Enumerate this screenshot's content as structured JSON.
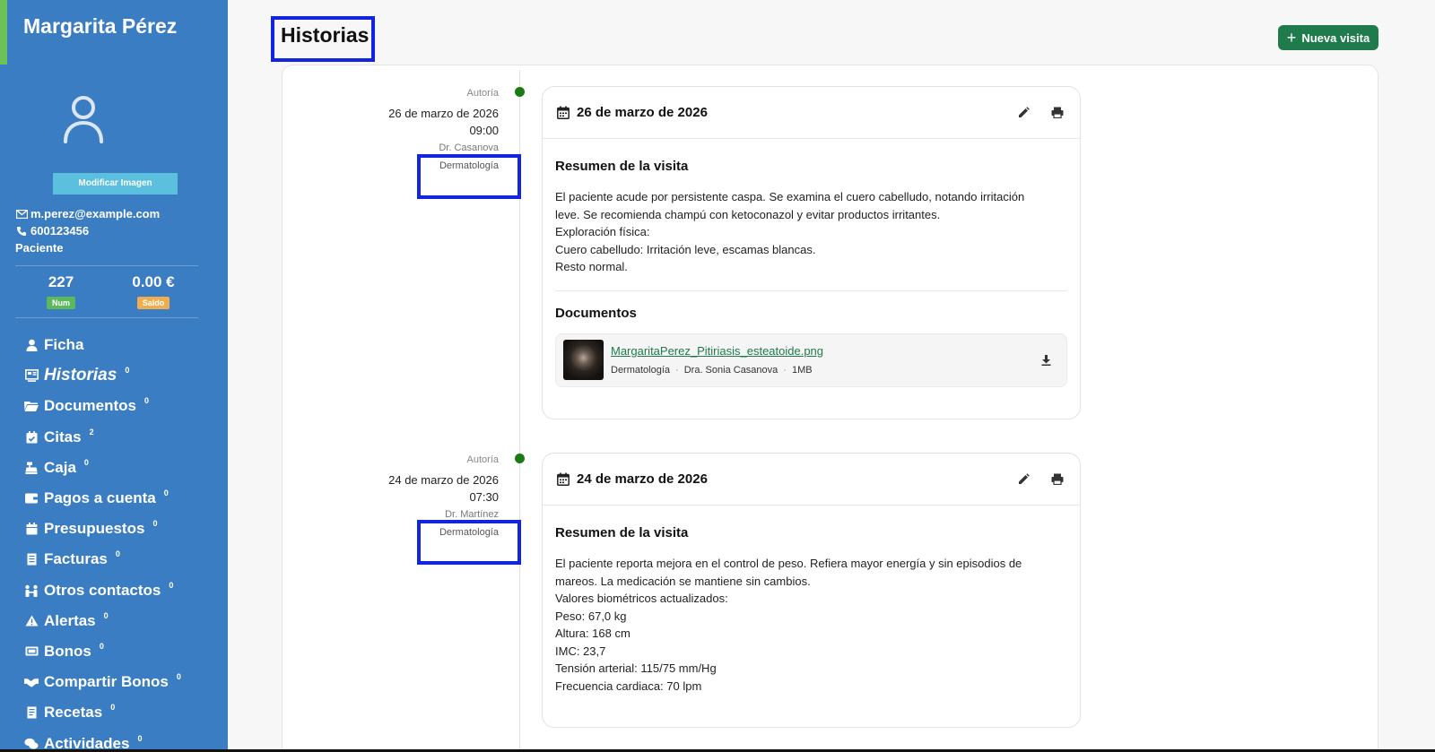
{
  "sidebar": {
    "patient_name": "Margarita Pérez",
    "modify_image_label": "Modificar Imagen",
    "email": "m.perez@example.com",
    "phone": "600123456",
    "role": "Paciente",
    "stats": [
      {
        "value": "227",
        "badge": "Num",
        "badge_color": "#5cb85c"
      },
      {
        "value": "0.00 €",
        "badge": "Saldo",
        "badge_color": "#f0ad4e"
      }
    ],
    "nav": [
      {
        "label": "Ficha",
        "count": "",
        "icon": "user-icon"
      },
      {
        "label": "Historias",
        "count": "0",
        "icon": "history-icon",
        "active": true
      },
      {
        "label": "Documentos",
        "count": "0",
        "icon": "folder-icon"
      },
      {
        "label": "Citas",
        "count": "2",
        "icon": "calendar-check-icon"
      },
      {
        "label": "Caja",
        "count": "0",
        "icon": "cash-register-icon"
      },
      {
        "label": "Pagos a cuenta",
        "count": "0",
        "icon": "wallet-icon"
      },
      {
        "label": "Presupuestos",
        "count": "0",
        "icon": "calendar-icon"
      },
      {
        "label": "Facturas",
        "count": "0",
        "icon": "invoice-icon"
      },
      {
        "label": "Otros contactos",
        "count": "0",
        "icon": "people-icon"
      },
      {
        "label": "Alertas",
        "count": "0",
        "icon": "warning-icon"
      },
      {
        "label": "Bonos",
        "count": "0",
        "icon": "ticket-icon"
      },
      {
        "label": "Compartir Bonos",
        "count": "0",
        "icon": "handshake-icon"
      },
      {
        "label": "Recetas",
        "count": "0",
        "icon": "prescription-icon"
      },
      {
        "label": "Actividades",
        "count": "0",
        "icon": "chat-icon"
      }
    ]
  },
  "header": {
    "title": "Historias",
    "new_visit_label": "Nueva visita"
  },
  "colors": {
    "sidebar_bg": "#3a7dc3",
    "accent_green": "#1f7a4c",
    "timeline_dot": "#1b7a12",
    "highlight": "#1124e0"
  },
  "visits": [
    {
      "meta": {
        "authorship": "Autoría",
        "date": "26 de marzo de 2026",
        "time": "09:00",
        "doctor": "Dr. Casanova",
        "specialty": "Dermatología"
      },
      "card_date": "26 de marzo de 2026",
      "summary_title": "Resumen de la visita",
      "summary_lines": [
        "El paciente acude por persistente caspa. Se examina el cuero cabelludo, notando irritación",
        "leve. Se recomienda champú con ketoconazol y evitar productos irritantes.",
        "Exploración física:",
        "Cuero cabelludo: Irritación leve, escamas blancas.",
        "Resto normal."
      ],
      "documents_title": "Documentos",
      "documents": [
        {
          "filename": "MargaritaPerez_Pitiriasis_esteatoide.png",
          "specialty": "Dermatología",
          "doctor": "Dra. Sonia Casanova",
          "size": "1MB"
        }
      ]
    },
    {
      "meta": {
        "authorship": "Autoría",
        "date": "24 de marzo de 2026",
        "time": "07:30",
        "doctor": "Dr. Martínez",
        "specialty": "Dermatología"
      },
      "card_date": "24 de marzo de 2026",
      "summary_title": "Resumen de la visita",
      "summary_lines": [
        "El paciente reporta mejora en el control de peso. Refiera mayor energía y sin episodios de",
        "mareos. La medicación se mantiene sin cambios.",
        "Valores biométricos actualizados:",
        "Peso: 67,0 kg",
        "Altura: 168 cm",
        "IMC: 23,7",
        "Tensión arterial: 115/75 mm/Hg",
        "Frecuencia cardiaca: 70 lpm"
      ]
    }
  ]
}
